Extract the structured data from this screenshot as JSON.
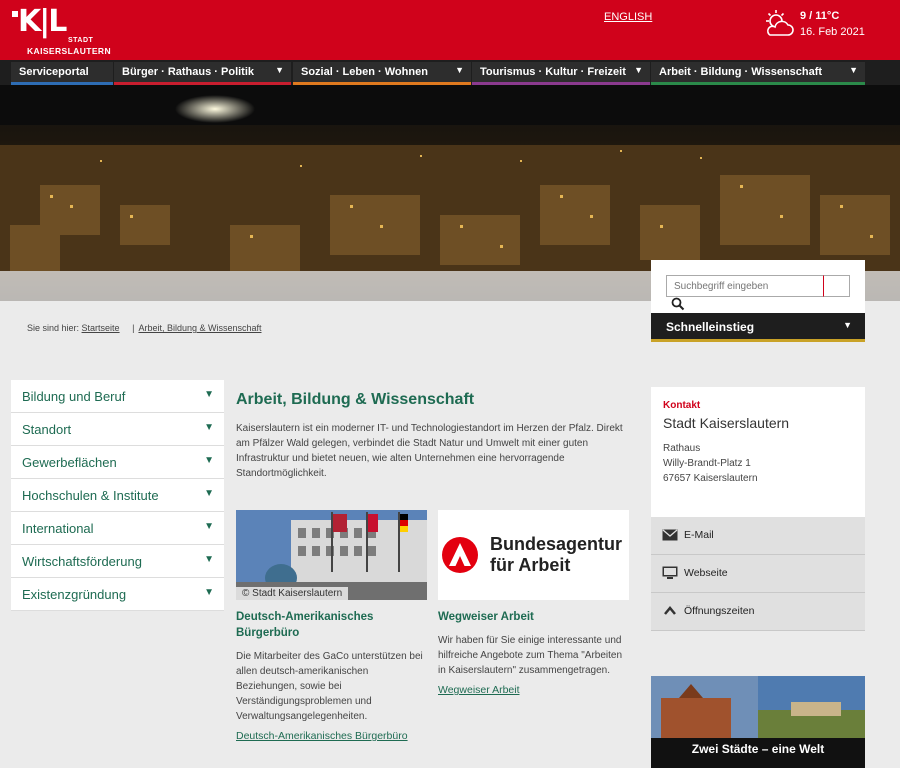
{
  "header": {
    "logo_mark": "K|L",
    "logo_stadt": "STADT",
    "logo_city": "KAISERSLAUTERN",
    "language_link": "ENGLISH",
    "weather": {
      "temperature": "9 / 11°C",
      "date": "16. Feb 2021",
      "icon": "sun-cloud-icon"
    }
  },
  "nav": {
    "items": [
      {
        "label": "Serviceportal",
        "accent": "#2e6db4",
        "dropdown": false
      },
      {
        "label": "Bürger · Rathaus · Politik",
        "accent": "#c81e2f",
        "dropdown": true
      },
      {
        "label": "Sozial · Leben · Wohnen",
        "accent": "#e07a1f",
        "dropdown": true
      },
      {
        "label": "Tourismus · Kultur · Freizeit",
        "accent": "#8b3a8f",
        "dropdown": true
      },
      {
        "label": "Arbeit · Bildung · Wissenschaft",
        "accent": "#2b8a4a",
        "dropdown": true
      }
    ]
  },
  "search": {
    "placeholder": "Suchbegriff eingeben",
    "quick_access": "Schnelleinstieg"
  },
  "breadcrumb": {
    "prefix": "Sie sind hier:",
    "items": [
      "Startseite",
      "Arbeit, Bildung & Wissenschaft"
    ]
  },
  "sidebar": {
    "items": [
      {
        "label": "Bildung und Beruf"
      },
      {
        "label": "Standort"
      },
      {
        "label": "Gewerbeflächen"
      },
      {
        "label": "Hochschulen & Institute"
      },
      {
        "label": "International"
      },
      {
        "label": "Wirtschaftsförderung"
      },
      {
        "label": "Existenzgründung"
      }
    ]
  },
  "main": {
    "title": "Arbeit, Bildung & Wissenschaft",
    "intro": "Kaiserslautern ist ein moderner IT- und Technologiestandort im Herzen der Pfalz. Direkt am Pfälzer Wald gelegen, verbindet die Stadt Natur und Umwelt mit einer guten Infrastruktur und bietet neuen, wie alten Unternehmen eine hervorragende Standortmöglichkeit.",
    "cards": [
      {
        "image_caption": "© Stadt Kaiserslautern",
        "title": "Deutsch-Amerikanisches Bürgerbüro",
        "text": "Die Mitarbeiter des GaCo unterstützen bei allen deutsch-amerikanischen Beziehungen, sowie bei Verständigungsproblemen und Verwaltungsangelegenheiten.",
        "link": "Deutsch-Amerikanisches Bürgerbüro"
      },
      {
        "logo_text_line1": "Bundesagentur",
        "logo_text_line2": "für Arbeit",
        "title": "Wegweiser Arbeit",
        "text": "Wir haben für Sie einige interessante und hilfreiche Angebote zum Thema \"Arbeiten in Kaiserslautern\" zusammengetragen.",
        "link": "Wegweiser Arbeit"
      }
    ]
  },
  "contact": {
    "label": "Kontakt",
    "name": "Stadt Kaiserslautern",
    "address_line1": "Rathaus",
    "address_line2": "Willy-Brandt-Platz 1",
    "address_line3": "67657 Kaiserslautern",
    "actions": [
      {
        "label": "E-Mail",
        "icon": "envelope-icon"
      },
      {
        "label": "Webseite",
        "icon": "monitor-icon"
      },
      {
        "label": "Öffnungszeiten",
        "icon": "chevron-up-icon"
      }
    ]
  },
  "promo": {
    "title": "Zwei Städte – eine Welt"
  },
  "colors": {
    "brand_red": "#d0021b",
    "link_green": "#1e6b52",
    "dark_nav": "#1e1e1e"
  }
}
